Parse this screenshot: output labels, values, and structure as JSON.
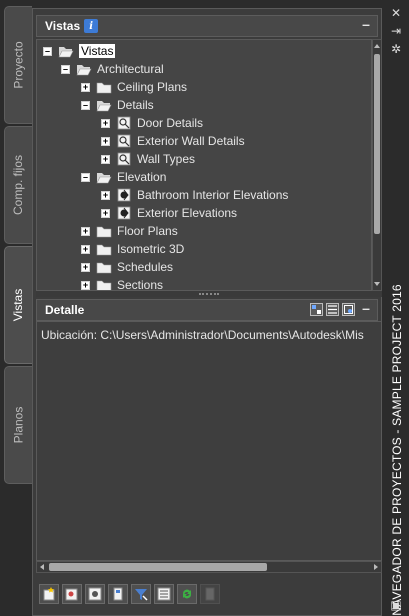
{
  "left_tabs": [
    {
      "label": "Proyecto",
      "active": false
    },
    {
      "label": "Comp. fijos",
      "active": false
    },
    {
      "label": "Vistas",
      "active": true
    },
    {
      "label": "Planos",
      "active": false
    }
  ],
  "vistas_section": {
    "title": "Vistas",
    "info_icon": "info-icon",
    "minimize": "–"
  },
  "tree": {
    "root": "Vistas",
    "architectural": "Architectural",
    "ceiling_plans": "Ceiling Plans",
    "details": "Details",
    "door_details": "Door Details",
    "exterior_wall_details": "Exterior Wall Details",
    "wall_types": "Wall Types",
    "elevation": "Elevation",
    "bathroom_interior_elevations": "Bathroom Interior Elevations",
    "exterior_elevations": "Exterior Elevations",
    "floor_plans": "Floor Plans",
    "isometric_3d": "Isometric 3D",
    "schedules": "Schedules",
    "sections": "Sections",
    "expand_symbol": "+",
    "collapse_symbol": "–"
  },
  "detalle_section": {
    "title": "Detalle",
    "minimize": "–",
    "location": "Ubicación: C:\\Users\\Administrador\\Documents\\Autodesk\\Mis"
  },
  "right_strip": {
    "title": "NAVEGADOR DE PROYECTOS - SAMPLE PROJECT 2016",
    "buttons": [
      "close-icon",
      "pin-icon",
      "settings-icon"
    ]
  },
  "colors": {
    "background": "#2b2b2b",
    "panel": "#3c3c3c",
    "selected": "#ffffff",
    "folder": "#f0f0f0"
  }
}
